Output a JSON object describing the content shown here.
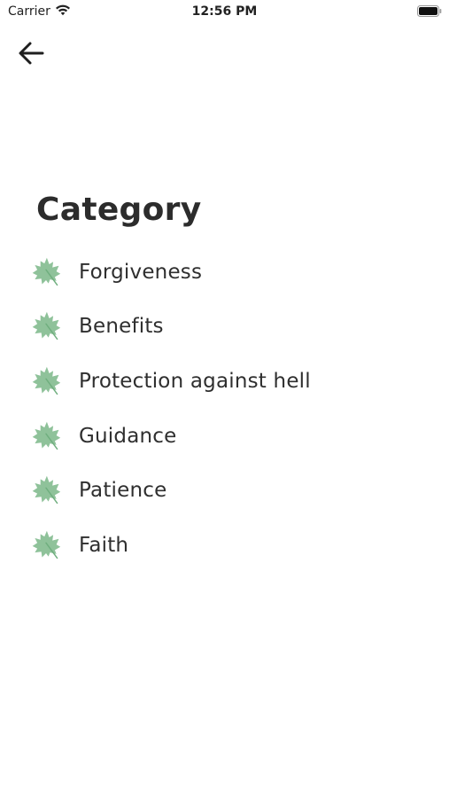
{
  "status_bar": {
    "carrier": "Carrier",
    "time": "12:56 PM",
    "icons": [
      "wifi-icon",
      "battery-icon"
    ]
  },
  "header": {
    "back_icon": "arrow-left-icon"
  },
  "main": {
    "title": "Category",
    "categories": [
      {
        "label": "Forgiveness",
        "icon": "maple-leaf-icon"
      },
      {
        "label": "Benefits",
        "icon": "maple-leaf-icon"
      },
      {
        "label": "Protection against hell",
        "icon": "maple-leaf-icon"
      },
      {
        "label": "Guidance",
        "icon": "maple-leaf-icon"
      },
      {
        "label": "Patience",
        "icon": "maple-leaf-icon"
      },
      {
        "label": "Faith",
        "icon": "maple-leaf-icon"
      }
    ]
  },
  "colors": {
    "leaf": "#8fc29a",
    "leaf_dark": "#6fae7e",
    "text": "#2c2c2c",
    "background": "#ffffff"
  }
}
